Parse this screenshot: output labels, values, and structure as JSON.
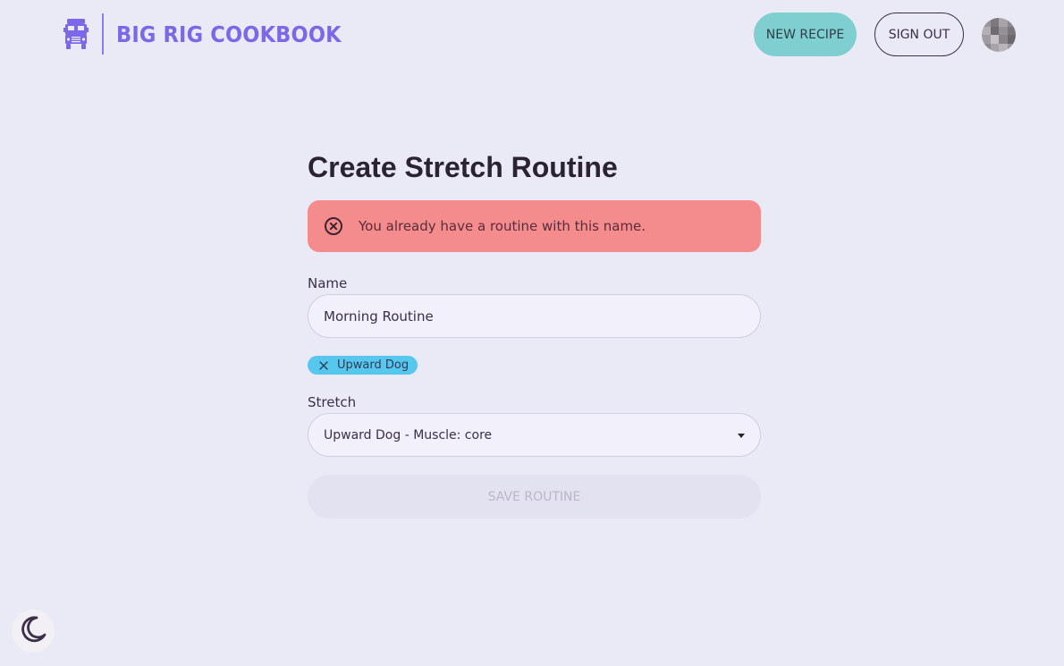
{
  "header": {
    "brand_title": "BIG RIG COOKBOOK",
    "brand_icon": "truck-icon",
    "new_recipe_label": "NEW RECIPE",
    "sign_out_label": "SIGN OUT",
    "avatar": "user-avatar"
  },
  "colors": {
    "background": "#eae9f6",
    "brand": "#7a68e8",
    "new_recipe_button": "#7fcfd0",
    "alert": "#f48b8c",
    "chip": "#57c7ee",
    "input_background": "#f1f0fb",
    "save_button_disabled": "#e3e2f0"
  },
  "main": {
    "page_title": "Create Stretch Routine",
    "alert": {
      "icon": "error-circle-icon",
      "message": "You already have a routine with this name."
    },
    "name_field": {
      "label": "Name",
      "value": "Morning Routine"
    },
    "selected_stretches": [
      {
        "label": "Upward Dog",
        "remove_icon": "close-icon"
      }
    ],
    "stretch_field": {
      "label": "Stretch",
      "selected_value": "Upward Dog - Muscle: core",
      "icon": "caret-down-icon"
    },
    "save_button": {
      "label": "SAVE ROUTINE",
      "disabled": true
    }
  },
  "footer": {
    "theme_toggle_icon": "moon-icon"
  }
}
